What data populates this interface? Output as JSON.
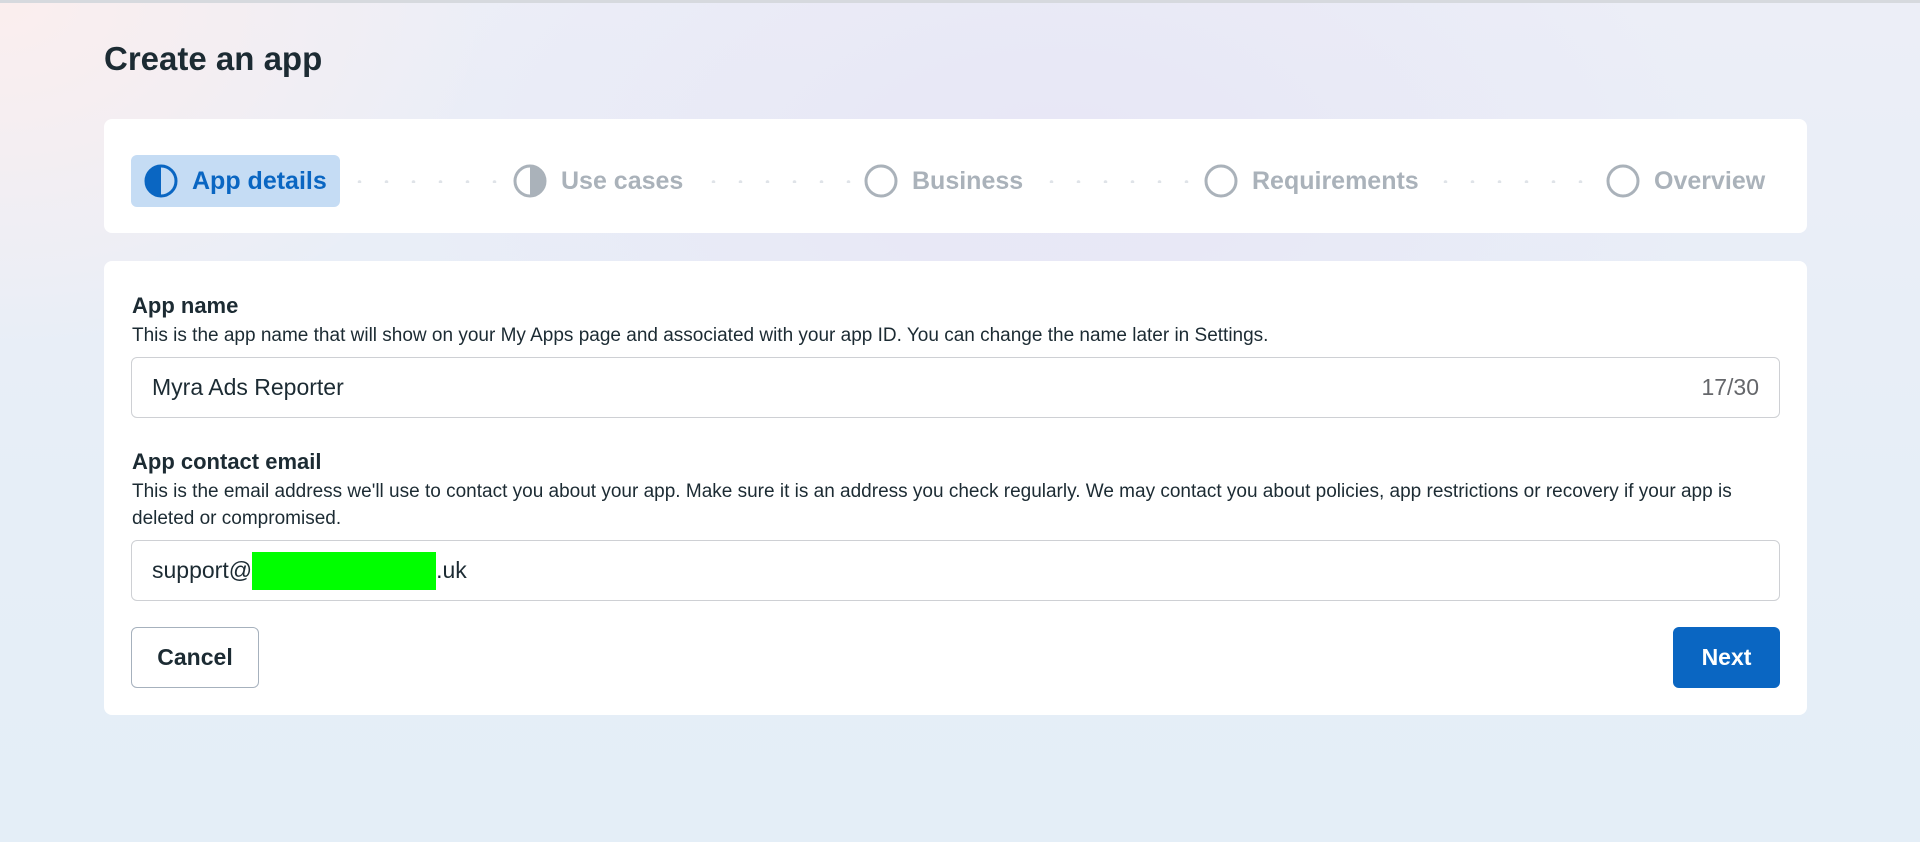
{
  "page": {
    "title": "Create an app"
  },
  "stepper": {
    "steps": [
      {
        "label": "App details",
        "state": "active",
        "icon": "half-filled-circle-icon"
      },
      {
        "label": "Use cases",
        "state": "pending",
        "icon": "half-filled-circle-icon"
      },
      {
        "label": "Business",
        "state": "pending",
        "icon": "empty-circle-icon"
      },
      {
        "label": "Requirements",
        "state": "pending",
        "icon": "empty-circle-icon"
      },
      {
        "label": "Overview",
        "state": "pending",
        "icon": "empty-circle-icon"
      }
    ]
  },
  "form": {
    "app_name": {
      "label": "App name",
      "description": "This is the app name that will show on your My Apps page and associated with your app ID. You can change the name later in Settings.",
      "value": "Myra Ads Reporter",
      "counter": "17/30"
    },
    "contact_email": {
      "label": "App contact email",
      "description": "This is the email address we'll use to contact you about your app. Make sure it is an address you check regularly. We may contact you about policies, app restrictions or recovery if your app is deleted or compromised.",
      "value_prefix": "support@",
      "value_suffix": ".uk"
    }
  },
  "actions": {
    "cancel_label": "Cancel",
    "next_label": "Next"
  },
  "colors": {
    "accent": "#0a66c2",
    "active_step_bg": "#c5dcf4",
    "inactive_text": "#aab2ba",
    "redaction": "#00ff00"
  }
}
